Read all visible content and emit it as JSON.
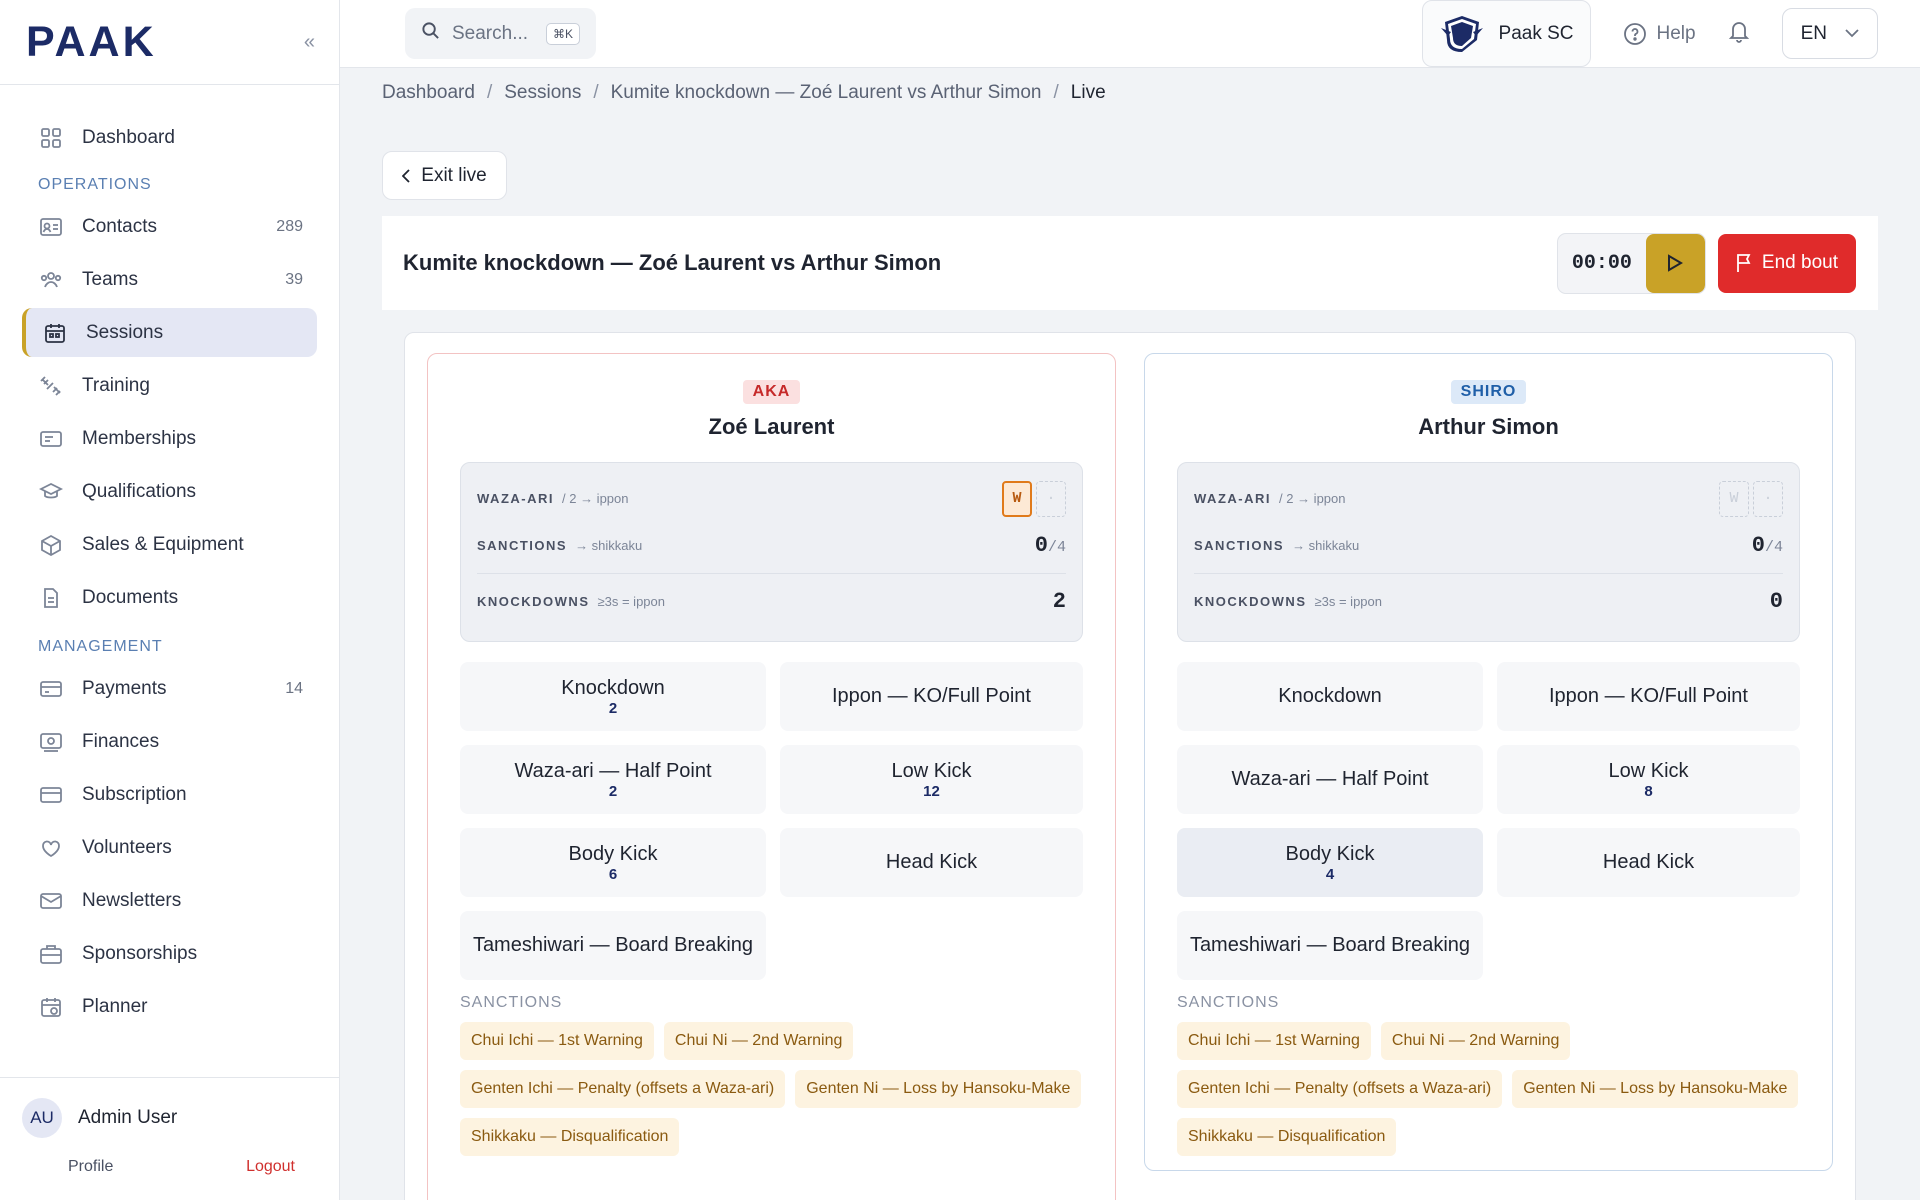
{
  "logo": "PAAK",
  "sidebar": {
    "nav_top": [
      {
        "label": "Dashboard",
        "icon": "grid-icon"
      }
    ],
    "operations_title": "OPERATIONS",
    "operations": [
      {
        "label": "Contacts",
        "count": "289"
      },
      {
        "label": "Teams",
        "count": "39"
      },
      {
        "label": "Sessions",
        "count": "",
        "active": true
      },
      {
        "label": "Training",
        "count": ""
      },
      {
        "label": "Memberships",
        "count": ""
      },
      {
        "label": "Qualifications",
        "count": ""
      },
      {
        "label": "Sales & Equipment",
        "count": ""
      },
      {
        "label": "Documents",
        "count": ""
      }
    ],
    "management_title": "MANAGEMENT",
    "management": [
      {
        "label": "Payments",
        "count": "14"
      },
      {
        "label": "Finances",
        "count": ""
      },
      {
        "label": "Subscription",
        "count": ""
      },
      {
        "label": "Volunteers",
        "count": ""
      },
      {
        "label": "Newsletters",
        "count": ""
      },
      {
        "label": "Sponsorships",
        "count": ""
      },
      {
        "label": "Planner",
        "count": ""
      }
    ],
    "user": {
      "initials": "AU",
      "name": "Admin User",
      "profile": "Profile",
      "logout": "Logout"
    }
  },
  "topbar": {
    "search_placeholder": "Search...",
    "search_kbd": "⌘K",
    "club": "Paak SC",
    "help": "Help",
    "lang": "EN"
  },
  "breadcrumb": [
    "Dashboard",
    "Sessions",
    "Kumite knockdown — Zoé Laurent vs Arthur Simon",
    "Live"
  ],
  "exit_label": "Exit live",
  "bout": {
    "title": "Kumite knockdown — Zoé Laurent vs Arthur Simon",
    "timer": "00:00",
    "end_label": "End bout"
  },
  "score_labels": {
    "waza": "WAZA-ARI",
    "waza_sub": "/ 2 → ippon",
    "sanctions": "SANCTIONS",
    "sanctions_sub": "→ shikkaku",
    "knockdowns": "KNOCKDOWNS",
    "knockdowns_sub": "≥3s = ippon",
    "sanctions_den": "/4",
    "sanctions_section": "SANCTIONS"
  },
  "aka": {
    "badge": "AKA",
    "name": "Zoé Laurent",
    "waza_boxes": [
      "W",
      "·"
    ],
    "sanctions": "0",
    "knockdowns": "2",
    "techniques": [
      {
        "label": "Knockdown",
        "count": "2"
      },
      {
        "label": "Ippon — KO/Full Point",
        "count": ""
      },
      {
        "label": "Waza-ari — Half Point",
        "count": "2"
      },
      {
        "label": "Low Kick",
        "count": "12"
      },
      {
        "label": "Body Kick",
        "count": "6"
      },
      {
        "label": "Head Kick",
        "count": ""
      },
      {
        "label": "Tameshiwari — Board Breaking",
        "count": ""
      }
    ],
    "sanctions_list": [
      "Chui Ichi — 1st Warning",
      "Chui Ni — 2nd Warning",
      "Genten Ichi — Penalty (offsets a Waza-ari)",
      "Genten Ni — Loss by Hansoku-Make",
      "Shikkaku — Disqualification"
    ]
  },
  "shiro": {
    "badge": "SHIRO",
    "name": "Arthur Simon",
    "waza_boxes": [
      "W",
      "·"
    ],
    "sanctions": "0",
    "knockdowns": "0",
    "techniques": [
      {
        "label": "Knockdown",
        "count": ""
      },
      {
        "label": "Ippon — KO/Full Point",
        "count": ""
      },
      {
        "label": "Waza-ari — Half Point",
        "count": ""
      },
      {
        "label": "Low Kick",
        "count": "8"
      },
      {
        "label": "Body Kick",
        "count": "4"
      },
      {
        "label": "Head Kick",
        "count": ""
      },
      {
        "label": "Tameshiwari — Board Breaking",
        "count": ""
      }
    ],
    "sanctions_list": [
      "Chui Ichi — 1st Warning",
      "Chui Ni — 2nd Warning",
      "Genten Ichi — Penalty (offsets a Waza-ari)",
      "Genten Ni — Loss by Hansoku-Make",
      "Shikkaku — Disqualification"
    ]
  },
  "colors": {
    "brand": "#1c2b66",
    "accent_gold": "#c9a227",
    "danger": "#e02b2b",
    "aka": "#c62a2a",
    "shiro": "#1f5fa8"
  }
}
